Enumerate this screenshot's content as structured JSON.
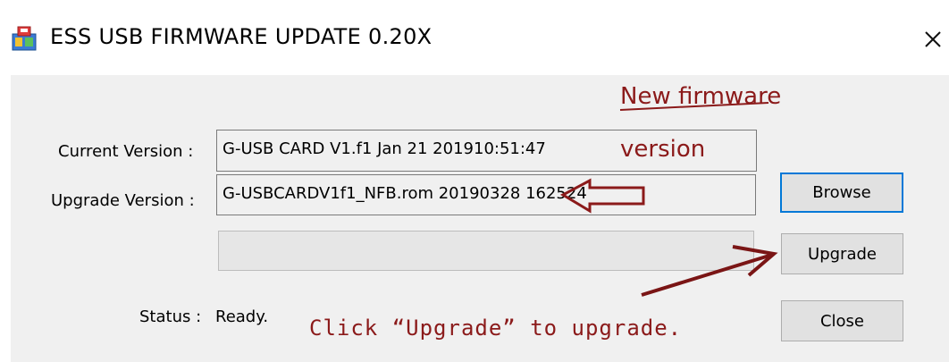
{
  "window": {
    "title": "ESS USB FIRMWARE UPDATE 0.20X",
    "app_icon": "installer-icon",
    "close_icon": "close-icon"
  },
  "form": {
    "current_version_label": "Current Version :",
    "current_version_value": "G-USB CARD V1.f1 Jan 21 201910:51:47",
    "upgrade_version_label": "Upgrade Version :",
    "upgrade_version_value": "G-USBCARDV1f1_NFB.rom 20190328 162524",
    "progress_percent": 0,
    "status_label": "Status :",
    "status_value": "Ready."
  },
  "buttons": {
    "browse": "Browse",
    "upgrade": "Upgrade",
    "close": "Close"
  },
  "annotations": {
    "new_firmware_line1": "New firmware",
    "new_firmware_line2": "version",
    "click_hint": "Click “Upgrade” to upgrade.",
    "color": "#8b1a1a"
  }
}
